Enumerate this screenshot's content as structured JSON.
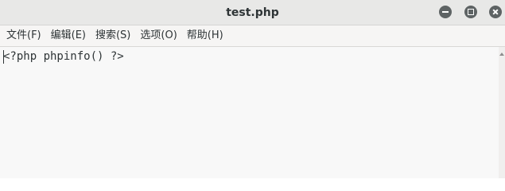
{
  "window": {
    "title": "test.php"
  },
  "menubar": {
    "items": [
      {
        "label": "文件(F)"
      },
      {
        "label": "编辑(E)"
      },
      {
        "label": "搜索(S)"
      },
      {
        "label": "选项(O)"
      },
      {
        "label": "帮助(H)"
      }
    ]
  },
  "editor": {
    "lines": [
      "<?php phpinfo() ?>"
    ]
  },
  "colors": {
    "titlebar_bg": "#e8e8e7",
    "window_button": "#5e6364",
    "editor_bg": "#f8f8f8",
    "text": "#2e3436"
  },
  "icons": {
    "minimize": "minimize-icon",
    "maximize": "maximize-icon",
    "close": "close-icon",
    "scroll_up": "chevron-up-icon"
  }
}
